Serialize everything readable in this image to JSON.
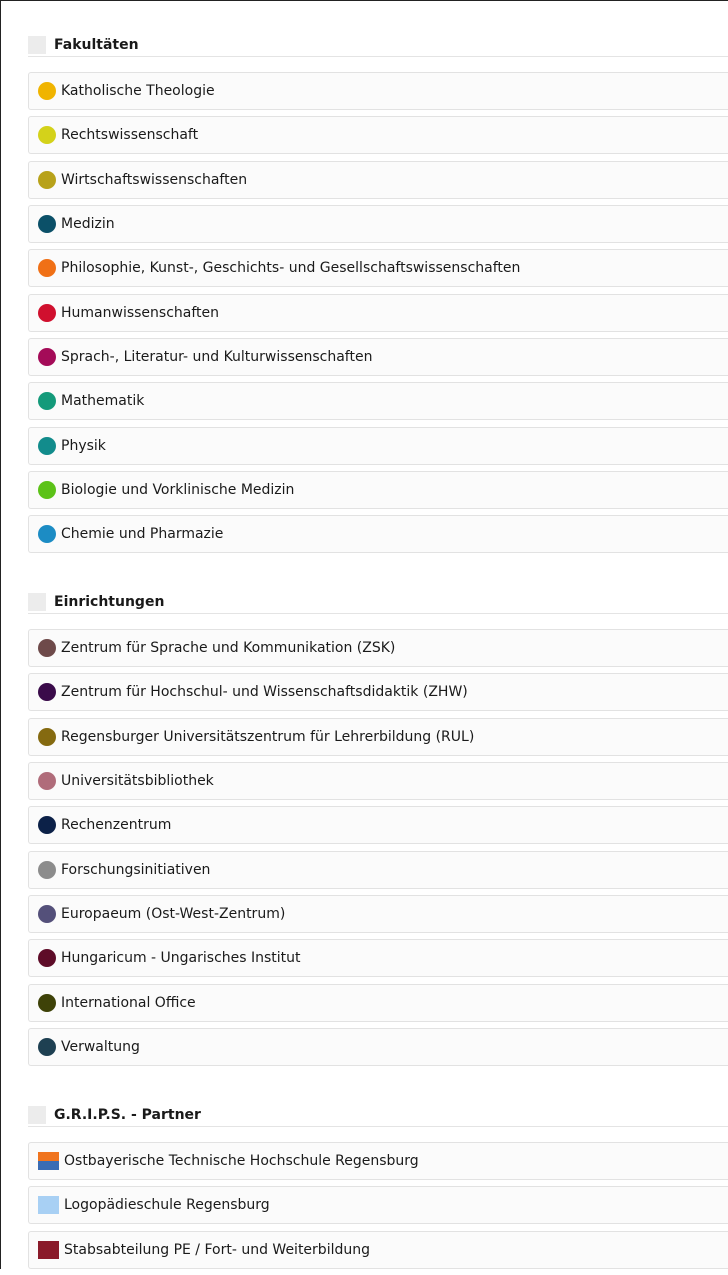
{
  "sections": [
    {
      "title": "Fakultäten",
      "items": [
        {
          "label": "Katholische Theologie",
          "color": "#f0b400",
          "icon": "faculty-dot-icon"
        },
        {
          "label": "Rechtswissenschaft",
          "color": "#d4d21a",
          "icon": "faculty-dot-icon"
        },
        {
          "label": "Wirtschaftswissenschaften",
          "color": "#b8a21a",
          "icon": "faculty-dot-icon"
        },
        {
          "label": "Medizin",
          "color": "#0b5068",
          "icon": "faculty-dot-icon"
        },
        {
          "label": "Philosophie, Kunst-, Geschichts- und Gesellschaftswissenschaften",
          "color": "#f07016",
          "icon": "faculty-dot-icon"
        },
        {
          "label": "Humanwissenschaften",
          "color": "#d0102e",
          "icon": "faculty-dot-icon"
        },
        {
          "label": "Sprach-, Literatur- und Kulturwissenschaften",
          "color": "#a40b58",
          "icon": "faculty-dot-icon"
        },
        {
          "label": "Mathematik",
          "color": "#149a7a",
          "icon": "faculty-dot-icon"
        },
        {
          "label": "Physik",
          "color": "#128c8c",
          "icon": "faculty-dot-icon"
        },
        {
          "label": "Biologie und Vorklinische Medizin",
          "color": "#5cc218",
          "icon": "faculty-dot-icon"
        },
        {
          "label": "Chemie und Pharmazie",
          "color": "#1c8cc4",
          "icon": "faculty-dot-icon"
        }
      ]
    },
    {
      "title": "Einrichtungen",
      "items": [
        {
          "label": "Zentrum für Sprache und Kommunikation (ZSK)",
          "color": "#6e4a4a",
          "icon": "institution-dot-icon"
        },
        {
          "label": "Zentrum für Hochschul- und Wissenschaftsdidaktik (ZHW)",
          "color": "#3a0b4a",
          "icon": "institution-dot-icon"
        },
        {
          "label": "Regensburger Universitätszentrum für Lehrerbildung (RUL)",
          "color": "#856a10",
          "icon": "institution-dot-icon"
        },
        {
          "label": "Universitätsbibliothek",
          "color": "#b06c7a",
          "icon": "institution-dot-icon"
        },
        {
          "label": "Rechenzentrum",
          "color": "#0c2148",
          "icon": "institution-dot-icon"
        },
        {
          "label": "Forschungsinitiativen",
          "color": "#8c8c8c",
          "icon": "institution-dot-icon"
        },
        {
          "label": "Europaeum (Ost-West-Zentrum)",
          "color": "#54507a",
          "icon": "institution-dot-icon"
        },
        {
          "label": "Hungaricum - Ungarisches Institut",
          "color": "#5e0c28",
          "icon": "institution-dot-icon"
        },
        {
          "label": "International Office",
          "color": "#3e4208",
          "icon": "institution-dot-icon"
        },
        {
          "label": "Verwaltung",
          "color": "#1e4052",
          "icon": "institution-dot-icon"
        }
      ]
    },
    {
      "title": "G.R.I.P.S. - Partner",
      "items": [
        {
          "label": "Ostbayerische Technische Hochschule Regensburg",
          "color_top": "#f0741e",
          "color_bottom": "#3a6cb4",
          "icon": "oth-logo-icon"
        },
        {
          "label": "Logopädieschule Regensburg",
          "color": "#a8d0f4",
          "icon": "partner-square-icon"
        },
        {
          "label": "Stabsabteilung PE / Fort- und Weiterbildung",
          "color": "#8a1a2a",
          "icon": "partner-square-icon"
        }
      ]
    }
  ]
}
